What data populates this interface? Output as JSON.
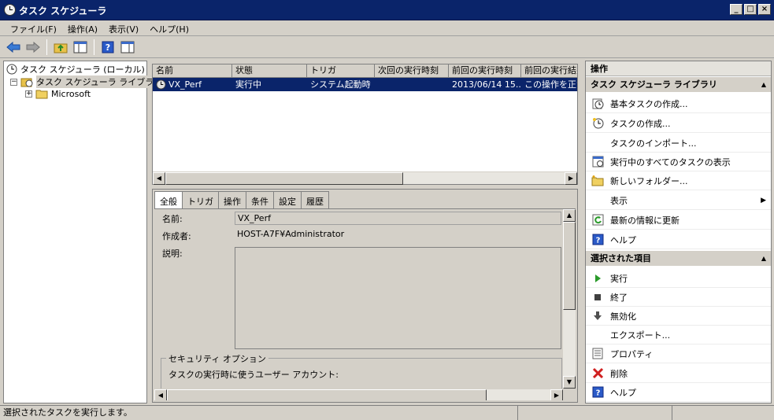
{
  "window": {
    "title": "タスク スケジューラ",
    "minimize": "_",
    "maximize": "□",
    "close": "×"
  },
  "menu": [
    "ファイル(F)",
    "操作(A)",
    "表示(V)",
    "ヘルプ(H)"
  ],
  "tree": {
    "root": "タスク スケジューラ (ローカル)",
    "library": "タスク スケジューラ ライブラリ",
    "child": "Microsoft",
    "expander_open": "−",
    "expander_closed": "+"
  },
  "task_list": {
    "columns": [
      "名前",
      "状態",
      "トリガ",
      "次回の実行時刻",
      "前回の実行時刻",
      "前回の実行結果"
    ],
    "rows": [
      {
        "name": "VX_Perf",
        "status": "実行中",
        "trigger": "システム起動時",
        "next_run": "",
        "last_run": "2013/06/14 15...",
        "last_result": "この操作を正常に終了しました。"
      }
    ]
  },
  "detail": {
    "tabs": [
      "全般",
      "トリガ",
      "操作",
      "条件",
      "設定",
      "履歴"
    ],
    "name_label": "名前:",
    "name_value": "VX_Perf",
    "author_label": "作成者:",
    "author_value": "HOST-A7F¥Administrator",
    "desc_label": "説明:",
    "security_title": "セキュリティ オプション",
    "security_text": "タスクの実行時に使うユーザー アカウント:"
  },
  "actions": {
    "header": "操作",
    "section1": "タスク スケジューラ ライブラリ",
    "items1": [
      "基本タスクの作成...",
      "タスクの作成...",
      "タスクのインポート...",
      "実行中のすべてのタスクの表示",
      "新しいフォルダー...",
      "表示",
      "最新の情報に更新",
      "ヘルプ"
    ],
    "section2": "選択された項目",
    "items2": [
      "実行",
      "終了",
      "無効化",
      "エクスポート...",
      "プロパティ",
      "削除",
      "ヘルプ"
    ],
    "collapse_glyph": "▲",
    "submenu_glyph": "▶"
  },
  "status": {
    "text": "選択されたタスクを実行します。"
  },
  "scroll": {
    "left": "◀",
    "right": "▶",
    "up": "▲",
    "down": "▼"
  }
}
